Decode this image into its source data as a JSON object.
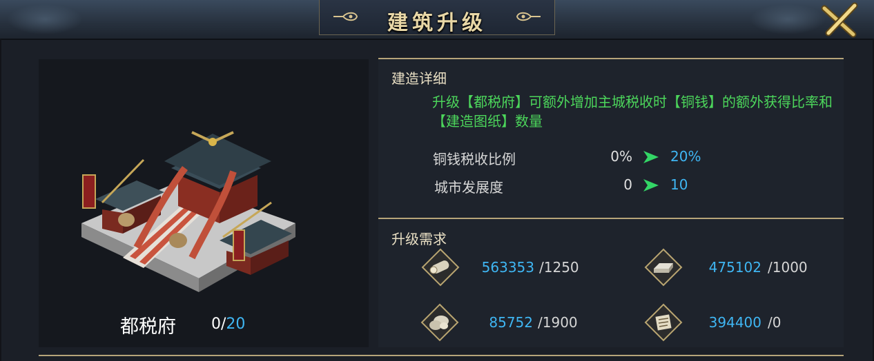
{
  "title": "建筑升级",
  "building": {
    "name": "都税府",
    "level_current": "0",
    "level_separator": "/",
    "level_max": "20"
  },
  "details": {
    "heading": "建造详细",
    "description": "升级【都税府】可额外增加主城税收时【铜钱】的额外获得比率和【建造图纸】数量",
    "stats": [
      {
        "label": "铜钱税收比例",
        "old": "0%",
        "new": "20%"
      },
      {
        "label": "城市发展度",
        "old": "0",
        "new": "10"
      }
    ]
  },
  "requirements": {
    "heading": "升级需求",
    "items": [
      {
        "icon": "wood-log-icon",
        "have": "563353",
        "need": "/1250"
      },
      {
        "icon": "iron-ingot-icon",
        "have": "475102",
        "need": "/1000"
      },
      {
        "icon": "stone-icon",
        "have": "85752",
        "need": "/1900"
      },
      {
        "icon": "blueprint-scroll-icon",
        "have": "394400",
        "need": "/0"
      }
    ]
  },
  "colors": {
    "accent_blue": "#3fb6f3",
    "desc_green": "#4cd65b",
    "gold": "#b7a57a"
  }
}
